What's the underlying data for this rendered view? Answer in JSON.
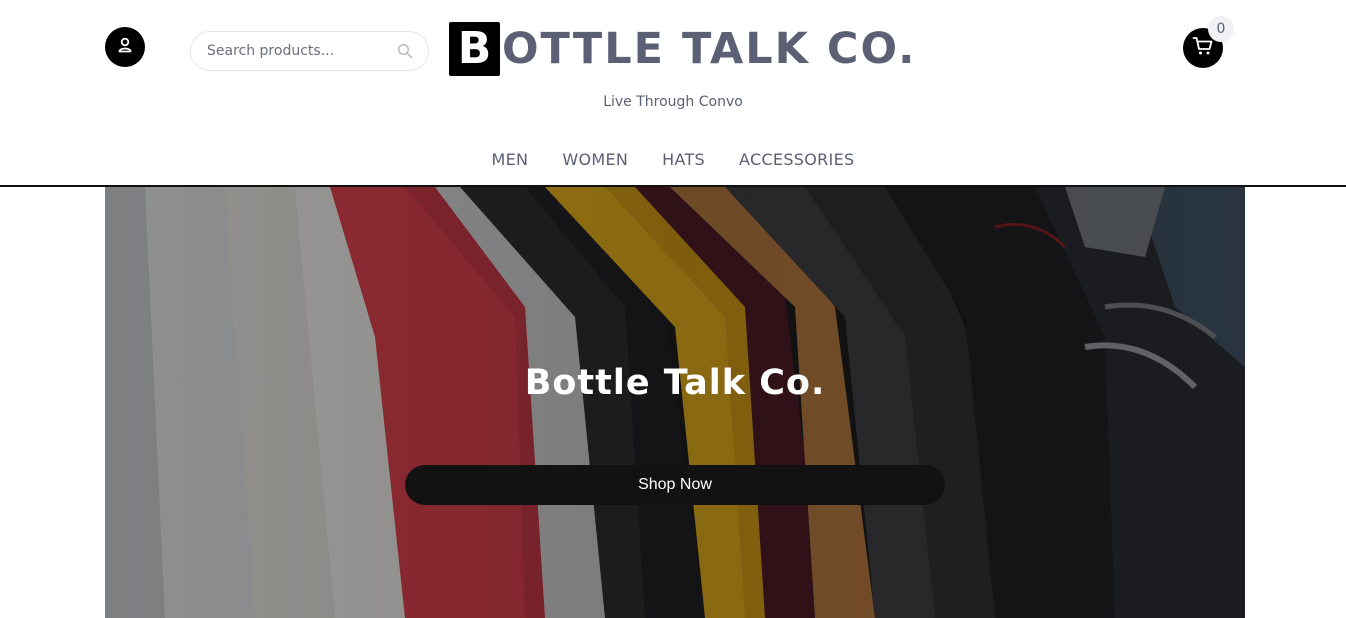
{
  "header": {
    "search_placeholder": "Search products...",
    "logo_letter": "B",
    "logo_rest": "OTTLE TALK CO.",
    "tagline": "Live Through Convo",
    "cart_count": "0"
  },
  "nav": {
    "items": [
      {
        "label": "MEN"
      },
      {
        "label": "WOMEN"
      },
      {
        "label": "HATS"
      },
      {
        "label": "ACCESSORIES"
      }
    ]
  },
  "hero": {
    "title": "Bottle Talk Co.",
    "button_label": "Shop Now"
  },
  "colors": {
    "brand_text": "#5b6075",
    "black": "#000000",
    "button": "#121212"
  },
  "icons": {
    "account": "user-icon",
    "search": "search-icon",
    "cart": "cart-icon"
  }
}
